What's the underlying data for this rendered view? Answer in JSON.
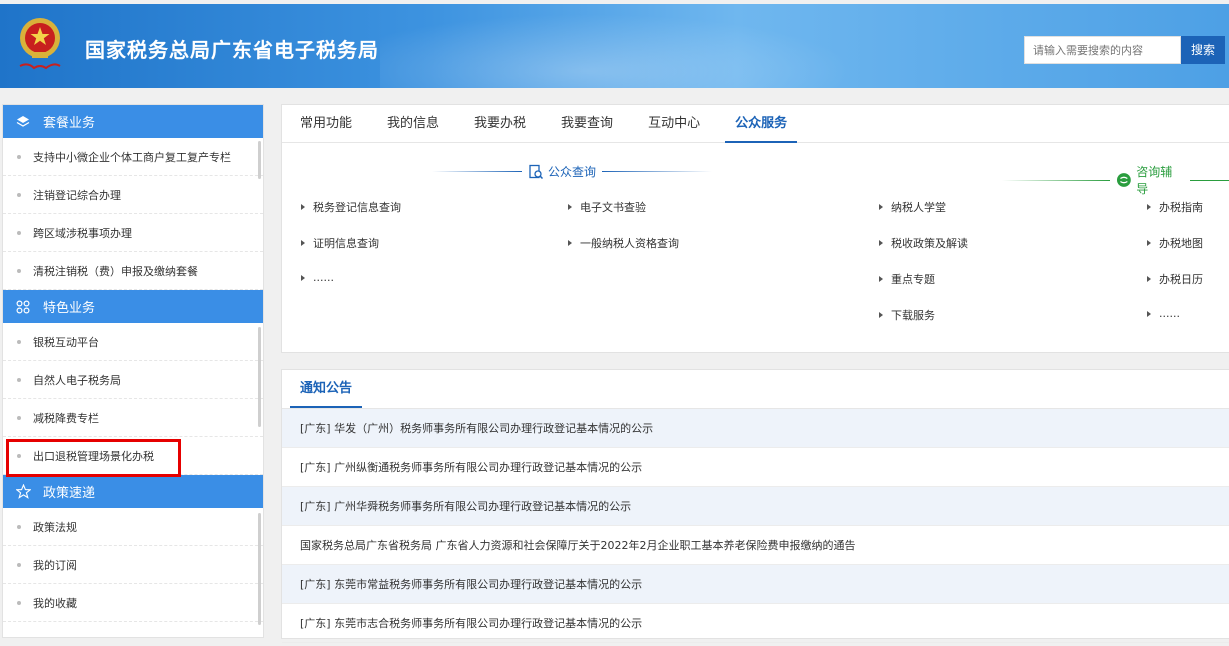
{
  "header": {
    "title": "国家税务总局广东省电子税务局",
    "search_placeholder": "请输入需要搜索的内容",
    "search_button": "搜索",
    "emblem_icon": "national-emblem-icon"
  },
  "sidebar": {
    "sections": [
      {
        "title": "套餐业务",
        "icon": "layers-icon",
        "items": [
          "支持中小微企业个体工商户复工复产专栏",
          "注销登记综合办理",
          "跨区域涉税事项办理",
          "清税注销税（费）申报及缴纳套餐"
        ]
      },
      {
        "title": "特色业务",
        "icon": "grid-icon",
        "items": [
          "银税互动平台",
          "自然人电子税务局",
          "减税降费专栏",
          "出口退税管理场景化办税"
        ]
      },
      {
        "title": "政策速递",
        "icon": "star-icon",
        "items": [
          "政策法规",
          "我的订阅",
          "我的收藏"
        ]
      }
    ]
  },
  "tabs": [
    "常用功能",
    "我的信息",
    "我要办税",
    "我要查询",
    "互动中心",
    "公众服务"
  ],
  "active_tab": "公众服务",
  "public_query": {
    "title": "公众查询",
    "items": [
      "税务登记信息查询",
      "电子文书查验",
      "证明信息查询",
      "一般纳税人资格查询",
      "......"
    ]
  },
  "consult": {
    "title": "咨询辅导",
    "col1": [
      "纳税人学堂",
      "税收政策及解读",
      "重点专题",
      "下载服务"
    ],
    "col2": [
      "办税指南",
      "办税地图",
      "办税日历",
      "......"
    ]
  },
  "notice": {
    "tab": "通知公告",
    "rows": [
      "[广东] 华发（广州）税务师事务所有限公司办理行政登记基本情况的公示",
      "[广东] 广州纵衡通税务师事务所有限公司办理行政登记基本情况的公示",
      "[广东] 广州华舜税务师事务所有限公司办理行政登记基本情况的公示",
      "国家税务总局广东省税务局 广东省人力资源和社会保障厅关于2022年2月企业职工基本养老保险费申报缴纳的通告",
      "[广东] 东莞市常益税务师事务所有限公司办理行政登记基本情况的公示",
      "[广东] 东莞市志合税务师事务所有限公司办理行政登记基本情况的公示"
    ]
  },
  "colors": {
    "header_blue": "#3d93e0",
    "accent_blue": "#1c63b7",
    "section_blue": "#3a8ee6",
    "consult_green": "#2a9d3e",
    "highlight_red": "#e60000"
  }
}
